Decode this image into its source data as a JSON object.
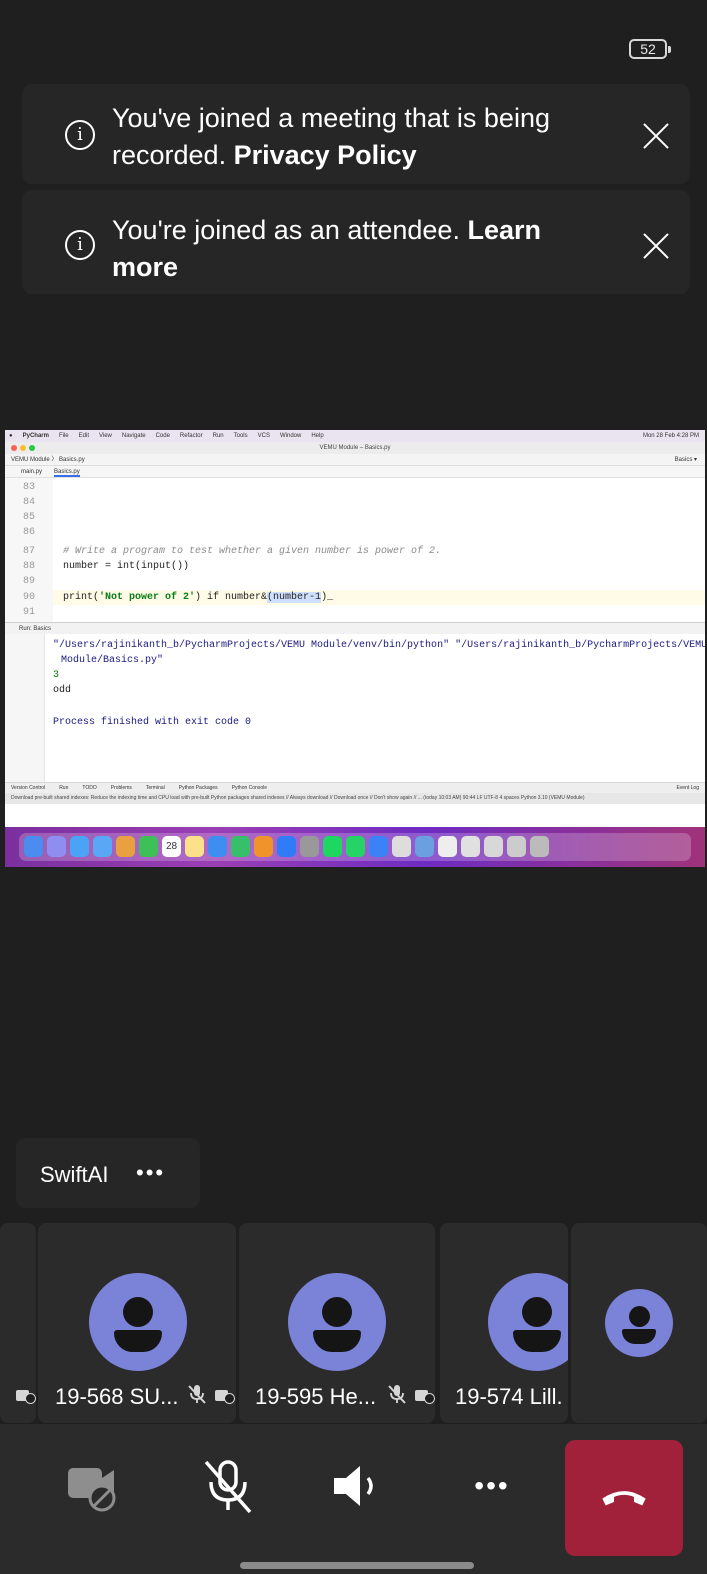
{
  "status": {
    "battery": "52"
  },
  "banners": [
    {
      "text": "You've joined a meeting that is being recorded. ",
      "link": "Privacy Policy"
    },
    {
      "text": "You're joined as an attendee. ",
      "link": "Learn more"
    }
  ],
  "shared_screen": {
    "menubar": [
      "PyCharm",
      "File",
      "Edit",
      "View",
      "Navigate",
      "Code",
      "Refactor",
      "Run",
      "Tools",
      "VCS",
      "Window",
      "Help"
    ],
    "clock": "Mon 28 Feb 4:28 PM",
    "window_title": "VEMU Module – Basics.py",
    "breadcrumb": "VEMU Module 〉 Basics.py",
    "run_config": "Basics ▾",
    "file_tabs": [
      "main.py",
      "Basics.py"
    ],
    "code": [
      {
        "ln": "83",
        "text": ""
      },
      {
        "ln": "84",
        "text": ""
      },
      {
        "ln": "85",
        "text": ""
      },
      {
        "ln": "86",
        "text": ""
      },
      {
        "ln": "87",
        "text": "# Write a program to test whether a given number is power of 2."
      },
      {
        "ln": "88",
        "text": "number = int(input())"
      },
      {
        "ln": "89",
        "text": ""
      },
      {
        "ln": "90",
        "text_a": "print(",
        "str": "'Not power of 2'",
        "text_b": ") if number&",
        "text_c": "(number-1",
        "text_d": ")_"
      },
      {
        "ln": "91",
        "text": ""
      }
    ],
    "run_tab": "Run:  Basics",
    "output": [
      "\"/Users/rajinikanth_b/PycharmProjects/VEMU Module/venv/bin/python\" \"/Users/rajinikanth_b/PycharmProjects/VEMU",
      "Module/Basics.py\"",
      "3",
      "odd",
      "",
      "Process finished with exit code 0"
    ],
    "bottom_tabs": [
      "Version Control",
      "Run",
      "TODO",
      "Problems",
      "Terminal",
      "Python Packages",
      "Python Console",
      "Event Log"
    ],
    "ide_status": "Download pre-built shared indexes: Reduce the indexing time and CPU load with pre-built Python packages shared indexes // Always download // Download once // Don't show again // ... (today 10:03 AM)     90:44  LF  UTF-8  4 spaces  Python 3.10 (VEMU Module)",
    "dock_calendar": "28"
  },
  "participants_label": {
    "name": "SwiftAI",
    "more": "•••"
  },
  "tiles": [
    {
      "name": "19-568 SU..."
    },
    {
      "name": "19-595 He..."
    },
    {
      "name": "19-574 Lill."
    }
  ],
  "controls": {
    "camera": "camera-off",
    "mic": "mic-off",
    "speaker": "speaker",
    "more": "•••",
    "leave": "hang-up"
  },
  "colors": {
    "avatar": "#7b83d9",
    "hangup": "#a2213a",
    "background": "#1f1f1f"
  }
}
